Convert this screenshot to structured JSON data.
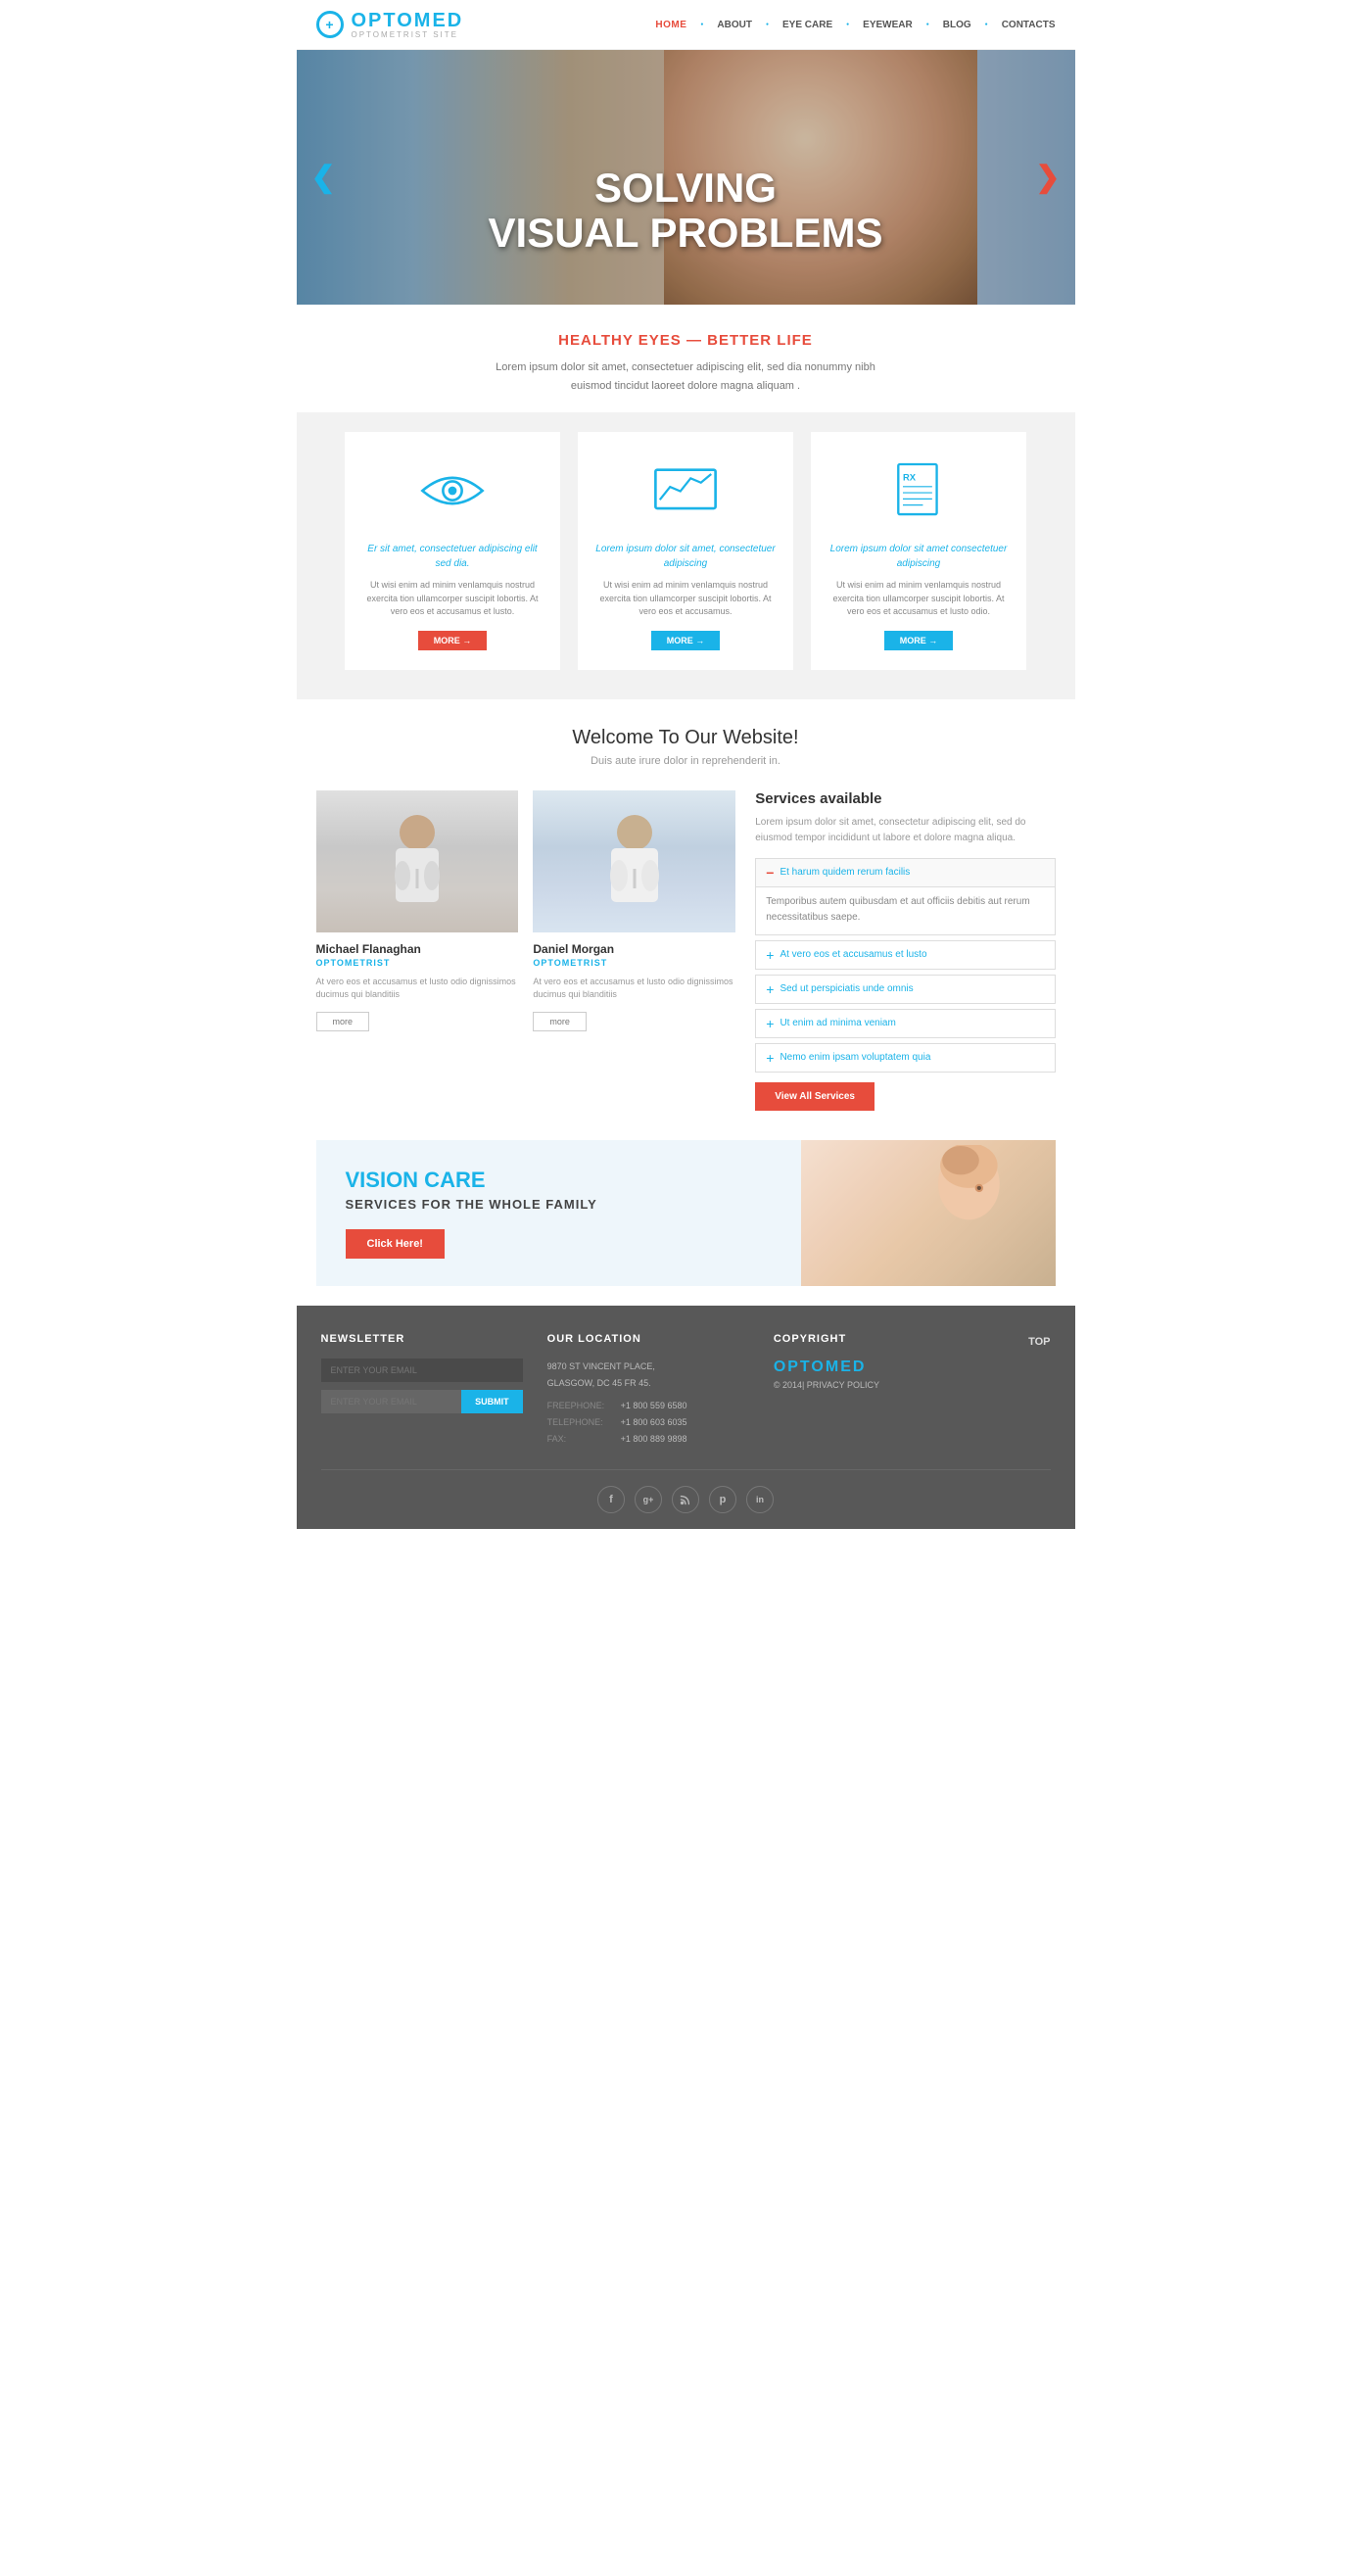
{
  "header": {
    "logo_text": "OPTOMED",
    "logo_sub": "OPTOMETRIST SITE",
    "logo_symbol": "+",
    "nav": {
      "home": "HOME",
      "about": "ABOUT",
      "eye_care": "EYE CARE",
      "eyewear": "EYEWEAR",
      "blog": "BLOG",
      "contacts": "CONTACTS"
    }
  },
  "hero": {
    "line1": "SOLVING",
    "line2": "VISUAL PROBLEMS",
    "arrow_left": "❮",
    "arrow_right": "❯"
  },
  "intro": {
    "heading": "HEALTHY EYES — BETTER LIFE",
    "text": "Lorem ipsum dolor sit amet, consectetuer adipiscing elit, sed dia nonummy nibh euismod tincidut laoreet dolore magna aliquam ."
  },
  "features": [
    {
      "icon": "eye",
      "title": "Er sit amet, consectetuer adipiscing elit sed dia.",
      "text": "Ut wisi enim ad minim venlamquis nostrud exercita tion ullamcorper suscipit lobortis. At vero eos et accusamus et lusto.",
      "btn": "MORE →",
      "btn_color": "red"
    },
    {
      "icon": "chart",
      "title": "Lorem ipsum dolor sit amet, consectetuer adipiscing",
      "text": "Ut wisi enim ad minim venlamquis nostrud exercita tion ullamcorper suscipit lobortis. At vero eos et accusamus.",
      "btn": "MORE →",
      "btn_color": "blue"
    },
    {
      "icon": "rx",
      "title": "Lorem ipsum dolor sit amet consectetuer adipiscing",
      "text": "Ut wisi enim ad minim venlamquis nostrud exercita tion ullamcorper suscipit lobortis. At vero eos et accusamus et lusto odio.",
      "btn": "MORE →",
      "btn_color": "blue"
    }
  ],
  "welcome": {
    "heading": "Welcome To Our Website!",
    "subtext": "Duis aute irure dolor in reprehenderit in."
  },
  "doctors": [
    {
      "name": "Michael Flanaghan",
      "role": "OPTOMETRIST",
      "text": "At vero eos et accusamus et lusto odio dignissimos ducimus qui blanditiis",
      "btn": "more"
    },
    {
      "name": "Daniel Morgan",
      "role": "OPTOMETRIST",
      "text": "At vero eos et accusamus et lusto odio dignissimos ducimus qui blanditiis",
      "btn": "more"
    }
  ],
  "services": {
    "title": "Services available",
    "text": "Lorem ipsum dolor sit amet, consectetur adipiscing elit, sed do eiusmod tempor incididunt ut labore et dolore magna aliqua.",
    "expanded_item": "Et harum quidem rerum facilis",
    "expanded_text": "Temporibus autem quibusdam et aut officiis debitis aut rerum necessitatibus saepe.",
    "items": [
      "At vero eos et accusamus et lusto",
      "Sed ut perspiciatis unde omnis",
      "Ut enim ad minima veniam",
      "Nemo enim ipsam voluptatem quia"
    ],
    "btn": "View All Services"
  },
  "vision_banner": {
    "title": "VISION CARE",
    "subtitle": "SERVICES FOR THE WHOLE FAMILY",
    "btn": "Click Here!"
  },
  "footer": {
    "newsletter": {
      "title": "NEWSLETTER",
      "placeholder1": "ENTER YOUR EMAIL",
      "placeholder2": "ENTER YOUR EMAIL",
      "btn": "SUBMIT"
    },
    "location": {
      "title": "OUR LOCATION",
      "address1": "9870 ST VINCENT PLACE,",
      "address2": "GLASGOW, DC 45 FR 45.",
      "freephone_label": "FREEPHONE:",
      "freephone": "+1 800 559 6580",
      "telephone_label": "TELEPHONE:",
      "telephone": "+1 800 603 6035",
      "fax_label": "FAX:",
      "fax": "+1 800 889 9898"
    },
    "copyright": {
      "title": "COPYRIGHT",
      "brand": "OPTOMED",
      "text": "© 2014| PRIVACY POLICY"
    },
    "top": "TOP",
    "social": [
      "f",
      "g+",
      "rss",
      "p",
      "in"
    ]
  }
}
